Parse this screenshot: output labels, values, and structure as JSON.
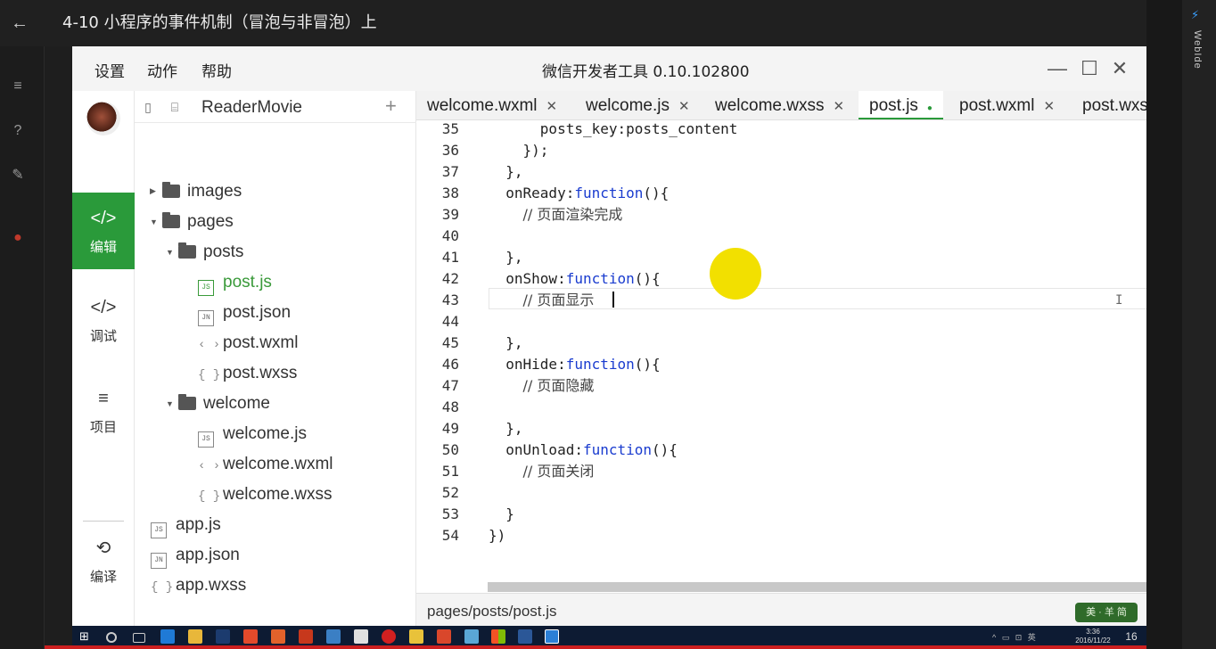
{
  "player": {
    "title": "4-10 小程序的事件机制（冒泡与非冒泡）上",
    "back_icon": "←",
    "rail_icons": [
      "≡",
      "?",
      "✎",
      "●"
    ],
    "webide_label": "WebIde"
  },
  "ide": {
    "menu": [
      "设置",
      "动作",
      "帮助"
    ],
    "title": "微信开发者工具 0.10.102800",
    "window_controls": {
      "minimize": "—",
      "maximize": "☐",
      "close": "✕"
    },
    "nav": {
      "edit": {
        "icon": "</>",
        "label": "编辑"
      },
      "debug": {
        "icon": "</>",
        "label": "调试"
      },
      "project": {
        "icon": "≡",
        "label": "项目"
      },
      "compile": {
        "icon": "⟲",
        "label": "编译"
      },
      "close": "✕"
    },
    "tree": {
      "project_name": "ReaderMovie",
      "add_symbol": "+",
      "view_icons": [
        "▯",
        "⌸"
      ],
      "nodes": [
        {
          "label": "images",
          "kind": "folder",
          "tri": "▶"
        },
        {
          "label": "pages",
          "kind": "folder",
          "tri": "▼"
        },
        {
          "label": "posts",
          "kind": "folder",
          "tri": "▼"
        },
        {
          "label": "post.js",
          "kind": "js",
          "icon": "JS"
        },
        {
          "label": "post.json",
          "kind": "json",
          "icon": "JN"
        },
        {
          "label": "post.wxml",
          "kind": "wxml",
          "icon": "‹ ›"
        },
        {
          "label": "post.wxss",
          "kind": "wxss",
          "icon": "{ }"
        },
        {
          "label": "welcome",
          "kind": "folder",
          "tri": "▼"
        },
        {
          "label": "welcome.js",
          "kind": "js",
          "icon": "JS"
        },
        {
          "label": "welcome.wxml",
          "kind": "wxml",
          "icon": "‹ ›"
        },
        {
          "label": "welcome.wxss",
          "kind": "wxss",
          "icon": "{ }"
        },
        {
          "label": "app.js",
          "kind": "js",
          "icon": "JS"
        },
        {
          "label": "app.json",
          "kind": "json",
          "icon": "JN"
        },
        {
          "label": "app.wxss",
          "kind": "wxss",
          "icon": "{ }"
        }
      ]
    },
    "tabs": [
      {
        "label": "welcome.wxml",
        "close": "✕"
      },
      {
        "label": "welcome.js",
        "close": "✕"
      },
      {
        "label": "welcome.wxss",
        "close": "✕"
      },
      {
        "label": "post.js",
        "modified": "●"
      },
      {
        "label": "post.wxml",
        "close": "✕"
      },
      {
        "label": "post.wxss"
      }
    ],
    "code": [
      {
        "ln": "35",
        "indent": "      ",
        "text": "posts_key:posts_content"
      },
      {
        "ln": "36",
        "indent": "    ",
        "text": "});"
      },
      {
        "ln": "37",
        "indent": "  ",
        "text": "},"
      },
      {
        "ln": "38",
        "indent": "  ",
        "pre": "onReady:",
        "kw": "function",
        "post": "(){"
      },
      {
        "ln": "39",
        "indent": "    ",
        "text": "// 页面渲染完成",
        "comment": true
      },
      {
        "ln": "40",
        "indent": "",
        "text": ""
      },
      {
        "ln": "41",
        "indent": "  ",
        "text": "},"
      },
      {
        "ln": "42",
        "indent": "  ",
        "pre": "onShow:",
        "kw": "function",
        "post": "(){"
      },
      {
        "ln": "43",
        "indent": "    ",
        "text": "// 页面显示",
        "comment": true
      },
      {
        "ln": "44",
        "indent": "",
        "text": ""
      },
      {
        "ln": "45",
        "indent": "  ",
        "text": "},"
      },
      {
        "ln": "46",
        "indent": "  ",
        "pre": "onHide:",
        "kw": "function",
        "post": "(){"
      },
      {
        "ln": "47",
        "indent": "    ",
        "text": "// 页面隐藏",
        "comment": true
      },
      {
        "ln": "48",
        "indent": "",
        "text": ""
      },
      {
        "ln": "49",
        "indent": "  ",
        "text": "},"
      },
      {
        "ln": "50",
        "indent": "  ",
        "pre": "onUnload:",
        "kw": "function",
        "post": "(){"
      },
      {
        "ln": "51",
        "indent": "    ",
        "text": "// 页面关闭",
        "comment": true
      },
      {
        "ln": "52",
        "indent": "",
        "text": ""
      },
      {
        "ln": "53",
        "indent": "  ",
        "text": "}"
      },
      {
        "ln": "54",
        "indent": "",
        "text": "})"
      }
    ],
    "ibeam": "I",
    "status": {
      "path": "pages/posts/post.js",
      "watermark": "美 · 羊 简"
    }
  },
  "taskbar": {
    "start_icon": "⊞",
    "tray": "^ ▭ ⊡ 英",
    "clock_time": "3:36",
    "clock_date": "2016/11/22",
    "notif_icon": "16"
  },
  "colors": {
    "accent_green": "#2a9a3a",
    "keyword_blue": "#1a3ccf",
    "cursor_yellow": "#f2e000",
    "taskbar": "#0d1b33",
    "progress_red": "#cc1f1f"
  }
}
